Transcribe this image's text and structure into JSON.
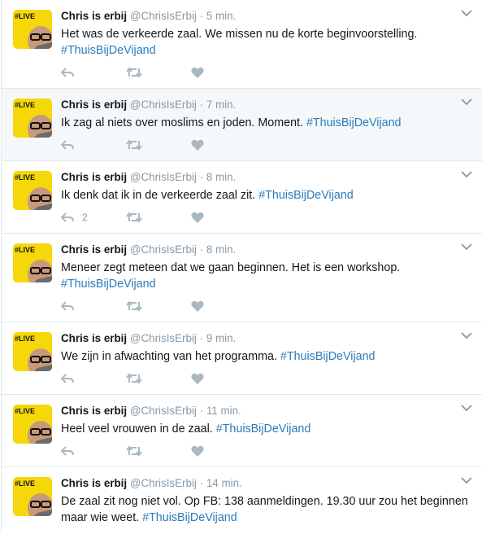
{
  "tweets": [
    {
      "name": "Chris is erbij",
      "handle": "@ChrisIsErbij",
      "sep": "·",
      "time": "5 min.",
      "text": "Het was de verkeerde zaal. We missen nu de korte beginvoorstelling. ",
      "hashtag": "#ThuisBijDeVijand",
      "reply_count": ""
    },
    {
      "name": "Chris is erbij",
      "handle": "@ChrisIsErbij",
      "sep": "·",
      "time": "7 min.",
      "text": "Ik zag al niets over moslims en joden. Moment. ",
      "hashtag": "#ThuisBijDeVijand",
      "reply_count": ""
    },
    {
      "name": "Chris is erbij",
      "handle": "@ChrisIsErbij",
      "sep": "·",
      "time": "8 min.",
      "text": "Ik denk dat ik in de verkeerde zaal zit. ",
      "hashtag": "#ThuisBijDeVijand",
      "reply_count": "2"
    },
    {
      "name": "Chris is erbij",
      "handle": "@ChrisIsErbij",
      "sep": "·",
      "time": "8 min.",
      "text": "Meneer zegt meteen dat we gaan beginnen. Het is een workshop. ",
      "hashtag": "#ThuisBijDeVijand",
      "reply_count": ""
    },
    {
      "name": "Chris is erbij",
      "handle": "@ChrisIsErbij",
      "sep": "·",
      "time": "9 min.",
      "text": "We zijn in afwachting van het programma. ",
      "hashtag": "#ThuisBijDeVijand",
      "reply_count": ""
    },
    {
      "name": "Chris is erbij",
      "handle": "@ChrisIsErbij",
      "sep": "·",
      "time": "11 min.",
      "text": "Heel veel vrouwen in de zaal. ",
      "hashtag": "#ThuisBijDeVijand",
      "reply_count": ""
    },
    {
      "name": "Chris is erbij",
      "handle": "@ChrisIsErbij",
      "sep": "·",
      "time": "14 min.",
      "text": "De zaal zit nog niet vol. Op FB: 138 aanmeldingen. 19.30 uur zou het beginnen maar wie weet. ",
      "hashtag": "#ThuisBijDeVijand",
      "reply_count": ""
    }
  ],
  "avatar_badge": "#LIVE",
  "colors": {
    "accent": "#2b7bb9",
    "muted": "#8899a6",
    "avatar_bg": "#f6d80a",
    "highlight_bg": "#f5f8fa"
  },
  "icons": {
    "reply": "reply-icon",
    "retweet": "retweet-icon",
    "like": "heart-icon",
    "menu": "chevron-down-icon"
  }
}
